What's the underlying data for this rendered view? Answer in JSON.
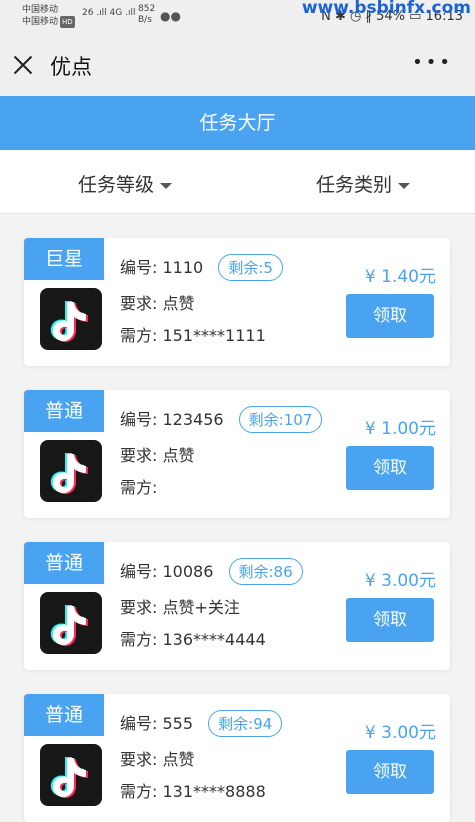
{
  "status_bar": {
    "carrier_1": "中国移动",
    "carrier_2": "中国移动",
    "hd_badge": "HD",
    "signal": "26 .ıll  4G .ıll",
    "speed_value": "852",
    "speed_unit": "B/s",
    "right_text": "N ✱ ◷ ∦ 54% ▭ 16:13"
  },
  "watermark": "www.bsbinfx.com",
  "header": {
    "title": "优点"
  },
  "banner": {
    "title": "任务大厅"
  },
  "filters": {
    "level": "任务等级",
    "category": "任务类别"
  },
  "tasks": [
    {
      "tag": "巨星",
      "id_label": "编号:",
      "id": "1110",
      "remaining": "剩余:5",
      "req_label": "要求:",
      "requirement": "点赞",
      "from_label": "需方:",
      "from": "151****1111",
      "price": "¥ 1.40元",
      "button": "领取"
    },
    {
      "tag": "普通",
      "id_label": "编号:",
      "id": "123456",
      "remaining": "剩余:107",
      "req_label": "要求:",
      "requirement": "点赞",
      "from_label": "需方:",
      "from": "",
      "price": "¥ 1.00元",
      "button": "领取"
    },
    {
      "tag": "普通",
      "id_label": "编号:",
      "id": "10086",
      "remaining": "剩余:86",
      "req_label": "要求:",
      "requirement": "点赞+关注",
      "from_label": "需方:",
      "from": "136****4444",
      "price": "¥ 3.00元",
      "button": "领取"
    },
    {
      "tag": "普通",
      "id_label": "编号:",
      "id": "555",
      "remaining": "剩余:94",
      "req_label": "要求:",
      "requirement": "点赞",
      "from_label": "需方:",
      "from": "131****8888",
      "price": "¥ 3.00元",
      "button": "领取"
    }
  ],
  "colors": {
    "accent": "#4aa3f0",
    "header_bg": "#efefef",
    "page_bg": "#f3f3f3"
  },
  "icons": {
    "logo": "tiktok-icon",
    "close": "close-icon",
    "more": "more-icon"
  }
}
